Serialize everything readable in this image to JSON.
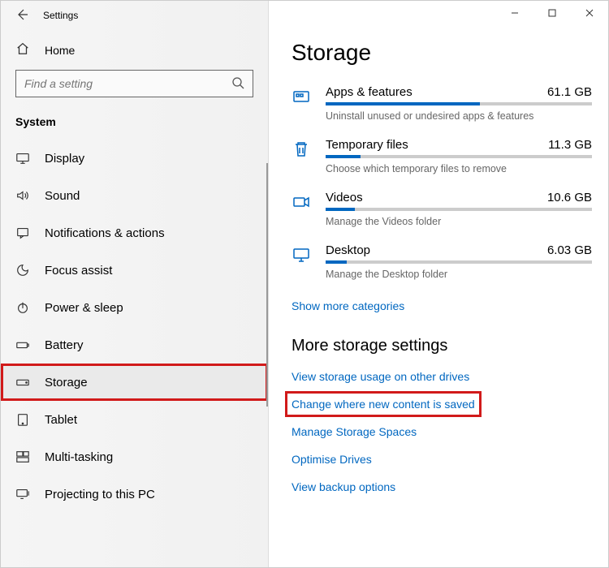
{
  "window": {
    "app_title": "Settings"
  },
  "sidebar": {
    "home_label": "Home",
    "search_placeholder": "Find a setting",
    "section_label": "System",
    "items": [
      {
        "label": "Display"
      },
      {
        "label": "Sound"
      },
      {
        "label": "Notifications & actions"
      },
      {
        "label": "Focus assist"
      },
      {
        "label": "Power & sleep"
      },
      {
        "label": "Battery"
      },
      {
        "label": "Storage"
      },
      {
        "label": "Tablet"
      },
      {
        "label": "Multi-tasking"
      },
      {
        "label": "Projecting to this PC"
      }
    ]
  },
  "main": {
    "title": "Storage",
    "categories": [
      {
        "name": "Apps & features",
        "size": "61.1 GB",
        "desc": "Uninstall unused or undesired apps & features",
        "fill_pct": 58
      },
      {
        "name": "Temporary files",
        "size": "11.3 GB",
        "desc": "Choose which temporary files to remove",
        "fill_pct": 13
      },
      {
        "name": "Videos",
        "size": "10.6 GB",
        "desc": "Manage the Videos folder",
        "fill_pct": 11
      },
      {
        "name": "Desktop",
        "size": "6.03 GB",
        "desc": "Manage the Desktop folder",
        "fill_pct": 8
      }
    ],
    "show_more": "Show more categories",
    "more_heading": "More storage settings",
    "more_links": [
      "View storage usage on other drives",
      "Change where new content is saved",
      "Manage Storage Spaces",
      "Optimise Drives",
      "View backup options"
    ]
  }
}
